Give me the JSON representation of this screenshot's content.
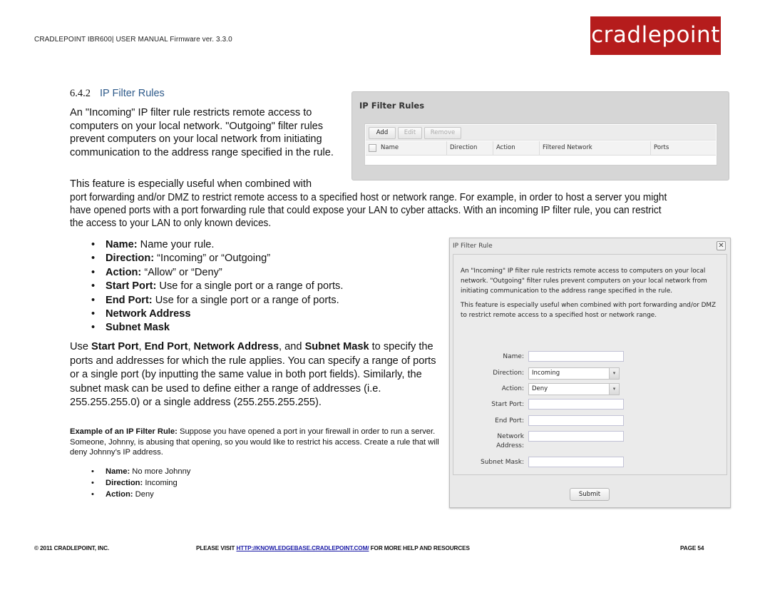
{
  "header": {
    "manual_title": "CRADLEPOINT IBR600| USER MANUAL Firmware ver. 3.3.0",
    "logo_text": "cradlepoint",
    "brand_color": "#b51c1c"
  },
  "section": {
    "number": "6.4.2",
    "title": "IP Filter Rules",
    "title_color": "#2e5a8a"
  },
  "intro": {
    "paragraph1": "An \"Incoming\" IP filter rule restricts remote access to computers on your local network. \"Outgoing\" filter rules prevent computers on your local network from initiating communication to the address range specified in the rule.",
    "paragraph2_line1": "This feature is especially useful when combined with",
    "paragraph2_rest": "port forwarding and/or DMZ to restrict remote access to a specified host or network range. For example, in order to host a server you might have opened ports with a port forwarding rule that could expose your LAN to cyber attacks. With an incoming IP filter rule, you can restrict the access to your LAN to only known devices."
  },
  "field_bullets": [
    {
      "term": "Name:",
      "desc": " Name your rule."
    },
    {
      "term": "Direction:",
      "desc": " “Incoming” or “Outgoing”"
    },
    {
      "term": "Action:",
      "desc": " “Allow” or “Deny”"
    },
    {
      "term": "Start Port:",
      "desc": " Use for a single port or a range of ports."
    },
    {
      "term": "End Port:",
      "desc": " Use for a single port or a range of ports."
    },
    {
      "term": "Network Address",
      "desc": ""
    },
    {
      "term": "Subnet Mask",
      "desc": ""
    }
  ],
  "usage": {
    "use": "Use ",
    "start_port": "Start Port",
    "sep1": ", ",
    "end_port": "End Port",
    "sep2": ", ",
    "network_address": "Network Address",
    "sep3": ", and ",
    "subnet_mask": "Subnet Mask",
    "rest": " to specify the ports and addresses for which the rule applies. You can specify a range of ports or a single port (by inputting the same value in both port fields). Similarly, the subnet mask can be used to define either a range of addresses (i.e. 255.255.255.0) or a single address (255.255.255.255)."
  },
  "example": {
    "label": "Example of an IP Filter Rule:",
    "text": " Suppose you have opened a port in your firewall in order to run a server. Someone, Johnny, is abusing that opening, so you would like to restrict his access. Create a rule that will deny Johnny’s IP address.",
    "bullets": [
      {
        "term": "Name:",
        "desc": " No more Johnny"
      },
      {
        "term": "Direction:",
        "desc": " Incoming"
      },
      {
        "term": "Action:",
        "desc": " Deny"
      }
    ]
  },
  "rules_panel": {
    "title": "IP Filter Rules",
    "buttons": {
      "add": "Add",
      "edit": "Edit",
      "remove": "Remove"
    },
    "columns": [
      "Name",
      "Direction",
      "Action",
      "Filtered Network",
      "Ports"
    ]
  },
  "rule_dialog": {
    "title": "IP Filter Rule",
    "close_glyph": "✕",
    "desc1": "An \"Incoming\" IP filter rule restricts remote access to computers on your local network. \"Outgoing\" filter rules prevent computers on your local network from initiating communication to the address range specified in the rule.",
    "desc2": "This feature is especially useful when combined with port forwarding and/or DMZ to restrict remote access to a specified host or network range.",
    "fields": {
      "name_label": "Name:",
      "name_value": "",
      "direction_label": "Direction:",
      "direction_value": "Incoming",
      "action_label": "Action:",
      "action_value": "Deny",
      "start_port_label": "Start Port:",
      "start_port_value": "",
      "end_port_label": "End Port:",
      "end_port_value": "",
      "network_label_1": "Network",
      "network_label_2": "Address:",
      "network_value": "",
      "subnet_label": "Subnet Mask:",
      "subnet_value": ""
    },
    "dropdown_arrow": "▾",
    "submit": "Submit"
  },
  "footer": {
    "copyright": "© 2011 CRADLEPOINT, INC.",
    "visit_prefix": "PLEASE VISIT ",
    "link": "HTTP://KNOWLEDGEBASE.CRADLEPOINT.COM/",
    "visit_suffix": " FOR MORE HELP AND RESOURCES",
    "page": "PAGE 54"
  }
}
